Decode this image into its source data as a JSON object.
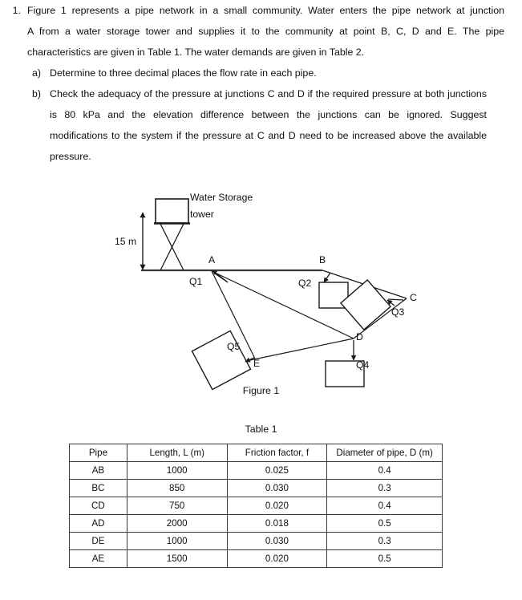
{
  "question": {
    "number": "1.",
    "lines": [
      "Figure 1 represents a pipe network in a small community. Water enters the pipe network at junction",
      "A from a water storage tower and supplies it to the community at point B, C, D and E. The pipe",
      "characteristics are given in Table 1. The water demands are given in Table 2."
    ],
    "sub_items": [
      {
        "label": "a)",
        "lines": [
          "Determine to three decimal places the flow rate in each pipe."
        ]
      },
      {
        "label": "b)",
        "lines": [
          "Check the adequacy of the pressure at junctions C and D if the required pressure at both junctions",
          "is 80 kPa and the elevation difference between the junctions can be ignored. Suggest",
          "modifications to the system if the pressure at C and D need to be increased above the available",
          "pressure."
        ]
      }
    ]
  },
  "figure": {
    "caption": "Figure 1",
    "tower_label_line1": "Water Storage",
    "tower_label_line2": "tower",
    "height_label": "15 m",
    "junctions": [
      {
        "id": "A",
        "label": "A"
      },
      {
        "id": "B",
        "label": "B"
      },
      {
        "id": "C",
        "label": "C"
      },
      {
        "id": "D",
        "label": "D"
      },
      {
        "id": "E",
        "label": "E"
      }
    ],
    "flows": [
      {
        "id": "Q1",
        "label": "Q1"
      },
      {
        "id": "Q2",
        "label": "Q2"
      },
      {
        "id": "Q3",
        "label": "Q3"
      },
      {
        "id": "Q4",
        "label": "Q4"
      },
      {
        "id": "Q5",
        "label": "Q5"
      }
    ],
    "line_color": "#1a1a1a"
  },
  "table1": {
    "title": "Table 1",
    "headers": [
      "Pipe",
      "Length, L (m)",
      "Friction factor, f",
      "Diameter of pipe, D (m)"
    ],
    "rows": [
      [
        "AB",
        "1000",
        "0.025",
        "0.4"
      ],
      [
        "BC",
        "850",
        "0.030",
        "0.3"
      ],
      [
        "CD",
        "750",
        "0.020",
        "0.4"
      ],
      [
        "AD",
        "2000",
        "0.018",
        "0.5"
      ],
      [
        "DE",
        "1000",
        "0.030",
        "0.3"
      ],
      [
        "AE",
        "1500",
        "0.020",
        "0.5"
      ]
    ]
  }
}
